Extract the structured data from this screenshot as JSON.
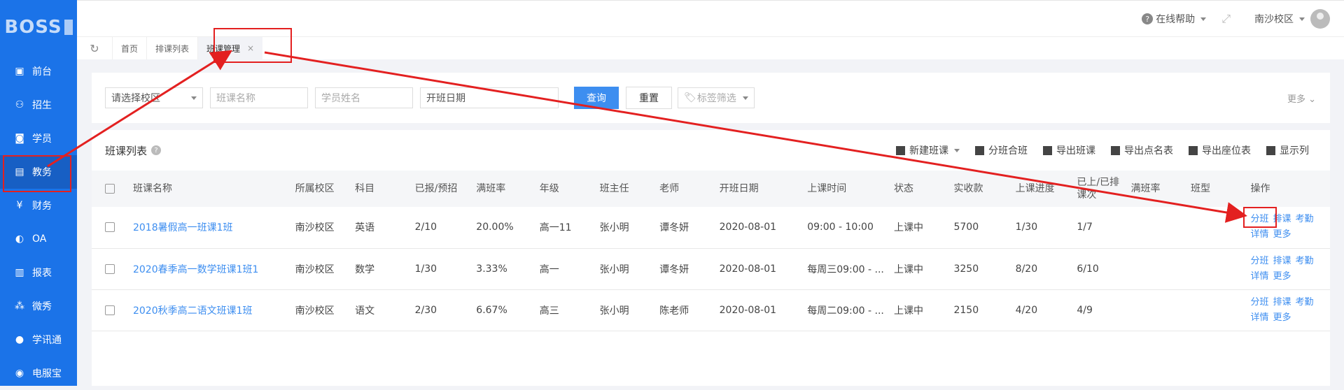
{
  "sidebar": {
    "logo": "BOSS",
    "items": [
      {
        "label": "前台",
        "icon": "calendar-icon"
      },
      {
        "label": "招生",
        "icon": "user-plus-icon"
      },
      {
        "label": "学员",
        "icon": "id-card-icon"
      },
      {
        "label": "教务",
        "icon": "book-icon"
      },
      {
        "label": "财务",
        "icon": "yen-icon"
      },
      {
        "label": "OA",
        "icon": "oa-icon"
      },
      {
        "label": "报表",
        "icon": "bar-chart-icon"
      },
      {
        "label": "微秀",
        "icon": "wechat-show-icon"
      },
      {
        "label": "学讯通",
        "icon": "location-icon"
      },
      {
        "label": "电服宝",
        "icon": "phone-service-icon"
      }
    ]
  },
  "topbar": {
    "help": "在线帮助",
    "campus": "南沙校区"
  },
  "tabs": {
    "home": "首页",
    "schedule_list": "排课列表",
    "class_mgmt": "班课管理",
    "close": "×"
  },
  "filter": {
    "campus_placeholder": "请选择校区",
    "class_name_placeholder": "班课名称",
    "student_placeholder": "学员姓名",
    "start_date": "开班日期",
    "search": "查询",
    "reset": "重置",
    "tag_filter": "标签筛选",
    "more": "更多"
  },
  "panel": {
    "title": "班课列表",
    "toolbar": [
      "新建班课",
      "分班合班",
      "导出班课",
      "导出点名表",
      "导出座位表",
      "显示列"
    ]
  },
  "table": {
    "headers": [
      "班课名称",
      "所属校区",
      "科目",
      "已报/预招",
      "满班率",
      "年级",
      "班主任",
      "老师",
      "开班日期",
      "上课时间",
      "状态",
      "实收款",
      "上课进度",
      "已上/已排课次",
      "满班率",
      "班型",
      "操作"
    ],
    "rows": [
      {
        "name": "2018暑假高一班课1班",
        "campus": "南沙校区",
        "subject": "英语",
        "enrolled": "2/10",
        "rate": "20.00%",
        "grade": "高一11",
        "head": "张小明",
        "teacher": "谭冬妍",
        "date": "2020-08-01",
        "time": "09:00 - 10:00",
        "status": "上课中",
        "paid": "5700",
        "progress": "1/30",
        "done": "1/7"
      },
      {
        "name": "2020春季高一数学班课1班1",
        "campus": "南沙校区",
        "subject": "数学",
        "enrolled": "1/30",
        "rate": "3.33%",
        "grade": "高一",
        "head": "张小明",
        "teacher": "谭冬妍",
        "date": "2020-08-01",
        "time": "每周三09:00 - ...",
        "status": "上课中",
        "paid": "3250",
        "progress": "8/20",
        "done": "6/10"
      },
      {
        "name": "2020秋季高二语文班课1班",
        "campus": "南沙校区",
        "subject": "语文",
        "enrolled": "2/30",
        "rate": "6.67%",
        "grade": "高三",
        "head": "张小明",
        "teacher": "陈老师",
        "date": "2020-08-01",
        "time": "每周二09:00 - ...",
        "status": "上课中",
        "paid": "2150",
        "progress": "4/20",
        "done": "4/9"
      }
    ],
    "ops": [
      "分班",
      "排课",
      "考勤",
      "详情",
      "更多"
    ]
  },
  "colors": {
    "sidebar": "#1b73e8",
    "primary": "#3d8ef0",
    "annotation": "#e32020"
  }
}
